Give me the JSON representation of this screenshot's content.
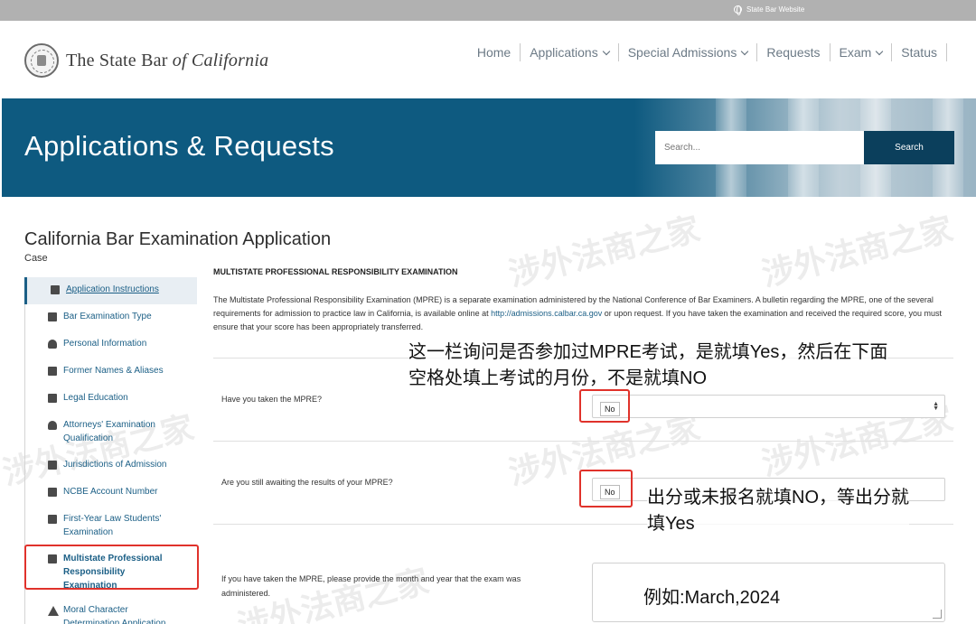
{
  "topbar": {
    "site_link": "State Bar Website"
  },
  "header": {
    "logo_text_main": "The State Bar ",
    "logo_text_italic": "of California",
    "nav": [
      {
        "label": "Home",
        "has_dropdown": false
      },
      {
        "label": "Applications",
        "has_dropdown": true
      },
      {
        "label": "Special Admissions",
        "has_dropdown": true
      },
      {
        "label": "Requests",
        "has_dropdown": false
      },
      {
        "label": "Exam",
        "has_dropdown": true
      },
      {
        "label": "Status",
        "has_dropdown": false
      }
    ]
  },
  "hero": {
    "title": "Applications & Requests",
    "search_placeholder": "Search...",
    "search_button": "Search"
  },
  "page": {
    "title": "California Bar Examination Application",
    "case_label": "Case"
  },
  "sidebar": {
    "items": [
      {
        "label": "Application Instructions",
        "icon": "list-icon"
      },
      {
        "label": "Bar Examination Type",
        "icon": "list-icon"
      },
      {
        "label": "Personal Information",
        "icon": "person-icon"
      },
      {
        "label": "Former Names & Aliases",
        "icon": "id-card-icon"
      },
      {
        "label": "Legal Education",
        "icon": "briefcase-icon"
      },
      {
        "label": "Attorneys' Examination Qualification",
        "icon": "attorney-icon"
      },
      {
        "label": "Jurisdictions of Admission",
        "icon": "building-icon"
      },
      {
        "label": "NCBE Account Number",
        "icon": "hash-icon"
      },
      {
        "label": "First-Year Law Students' Examination",
        "icon": "edit-doc-icon"
      },
      {
        "label": "Multistate Professional Responsibility Examination",
        "icon": "edit-doc-icon"
      },
      {
        "label": "Moral Character Determination Application",
        "icon": "warning-icon"
      }
    ]
  },
  "main": {
    "section_title": "MULTISTATE PROFESSIONAL RESPONSIBILITY EXAMINATION",
    "intro_before_link": "The Multistate Professional Responsibility Examination (MPRE) is a separate examination administered by the National Conference of Bar Examiners. A bulletin regarding the MPRE, one of the several requirements for admission to practice law in California, is available online at ",
    "intro_link": "http://admissions.calbar.ca.gov",
    "intro_after_link": " or upon request. If you have taken the examination and received the required score, you must ensure that your score has been appropriately transferred.",
    "q1_label": "Have you taken the MPRE?",
    "q1_value": "No",
    "q2_label": "Are you still awaiting the results of your MPRE?",
    "q2_value": "No",
    "q3_label_line1": "If you have taken the MPRE, please provide the month and year that the exam was",
    "q3_label_line2": "administered."
  },
  "annotations": {
    "note1_line1": "这一栏询问是否参加过MPRE考试，是就填Yes，然后在下面",
    "note1_line2": "空格处填上考试的月份，不是就填NO",
    "note2_line1": "出分或未报名就填NO，等出分就",
    "note2_line2": "填Yes",
    "note3": "例如:March,2024",
    "color": "#e0322b"
  },
  "watermark": {
    "text": "涉外法商之家"
  }
}
